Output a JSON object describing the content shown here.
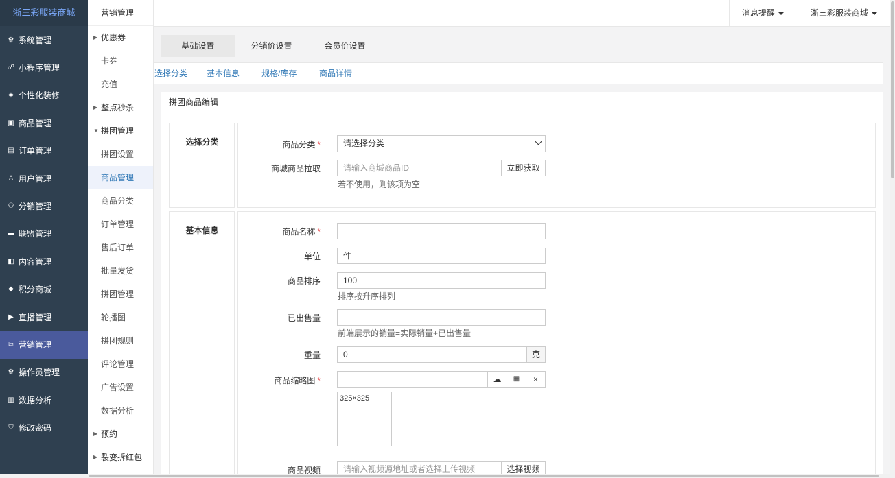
{
  "sidebar": {
    "brand": "浙三彩服装商城",
    "items": [
      {
        "label": "系统管理",
        "icon": "gear-icon",
        "glyph": "⚙"
      },
      {
        "label": "小程序管理",
        "icon": "link-icon",
        "glyph": "☍"
      },
      {
        "label": "个性化装修",
        "icon": "palette-icon",
        "glyph": "◈"
      },
      {
        "label": "商品管理",
        "icon": "bag-icon",
        "glyph": "▣"
      },
      {
        "label": "订单管理",
        "icon": "calendar-icon",
        "glyph": "▤"
      },
      {
        "label": "用户管理",
        "icon": "user-icon",
        "glyph": "♙"
      },
      {
        "label": "分销管理",
        "icon": "sitemap-icon",
        "glyph": "⚇"
      },
      {
        "label": "联盟管理",
        "icon": "store-icon",
        "glyph": "▬"
      },
      {
        "label": "内容管理",
        "icon": "news-icon",
        "glyph": "◧"
      },
      {
        "label": "积分商城",
        "icon": "cube-icon",
        "glyph": "◆"
      },
      {
        "label": "直播管理",
        "icon": "play-icon",
        "glyph": "▶"
      },
      {
        "label": "营销管理",
        "icon": "ticket-icon",
        "glyph": "⧉",
        "active": true
      },
      {
        "label": "操作员管理",
        "icon": "gear-icon",
        "glyph": "⚙"
      },
      {
        "label": "数据分析",
        "icon": "bar-chart-icon",
        "glyph": "▥"
      },
      {
        "label": "修改密码",
        "icon": "shield-icon",
        "glyph": "⛉"
      }
    ]
  },
  "submenu": {
    "title": "营销管理",
    "items": [
      {
        "label": "优惠券",
        "parent": true,
        "tri": "▶"
      },
      {
        "label": "卡券"
      },
      {
        "label": "充值"
      },
      {
        "label": "整点秒杀",
        "parent": true,
        "tri": "▶"
      },
      {
        "label": "拼团管理",
        "parent": true,
        "tri": "▼"
      },
      {
        "label": "拼团设置"
      },
      {
        "label": "商品管理",
        "active": true
      },
      {
        "label": "商品分类"
      },
      {
        "label": "订单管理"
      },
      {
        "label": "售后订单"
      },
      {
        "label": "批量发货"
      },
      {
        "label": "拼团管理"
      },
      {
        "label": "轮播图"
      },
      {
        "label": "拼团规则"
      },
      {
        "label": "评论管理"
      },
      {
        "label": "广告设置"
      },
      {
        "label": "数据分析"
      },
      {
        "label": "预约",
        "parent": true,
        "tri": "▶"
      },
      {
        "label": "裂变拆红包",
        "parent": true,
        "tri": "▶"
      }
    ]
  },
  "topbar": {
    "messages": "消息提醒",
    "store": "浙三彩服装商城"
  },
  "tabs": [
    "基础设置",
    "分销价设置",
    "会员价设置"
  ],
  "anchors": [
    "选择分类",
    "基本信息",
    "规格/库存",
    "商品详情"
  ],
  "panel": {
    "title": "拼团商品编辑",
    "section1": {
      "title": "选择分类",
      "category_label": "商品分类",
      "category_value": "请选择分类",
      "fetch_label": "商城商品拉取",
      "fetch_placeholder": "请输入商城商品ID",
      "fetch_button": "立即获取",
      "fetch_help": "若不使用，则该项为空"
    },
    "section2": {
      "title": "基本信息",
      "name_label": "商品名称",
      "name_value": "",
      "unit_label": "单位",
      "unit_value": "件",
      "sort_label": "商品排序",
      "sort_value": "100",
      "sort_help": "排序按升序排列",
      "sold_label": "已出售量",
      "sold_value": "",
      "sold_help": "前端展示的销量=实际销量+已出售量",
      "weight_label": "重量",
      "weight_value": "0",
      "weight_unit": "克",
      "thumb_label": "商品缩略图",
      "thumb_size": "325×325",
      "video_label": "商品视频",
      "video_placeholder": "请输入视频源地址或者选择上传视频",
      "video_button": "选择视频"
    }
  }
}
